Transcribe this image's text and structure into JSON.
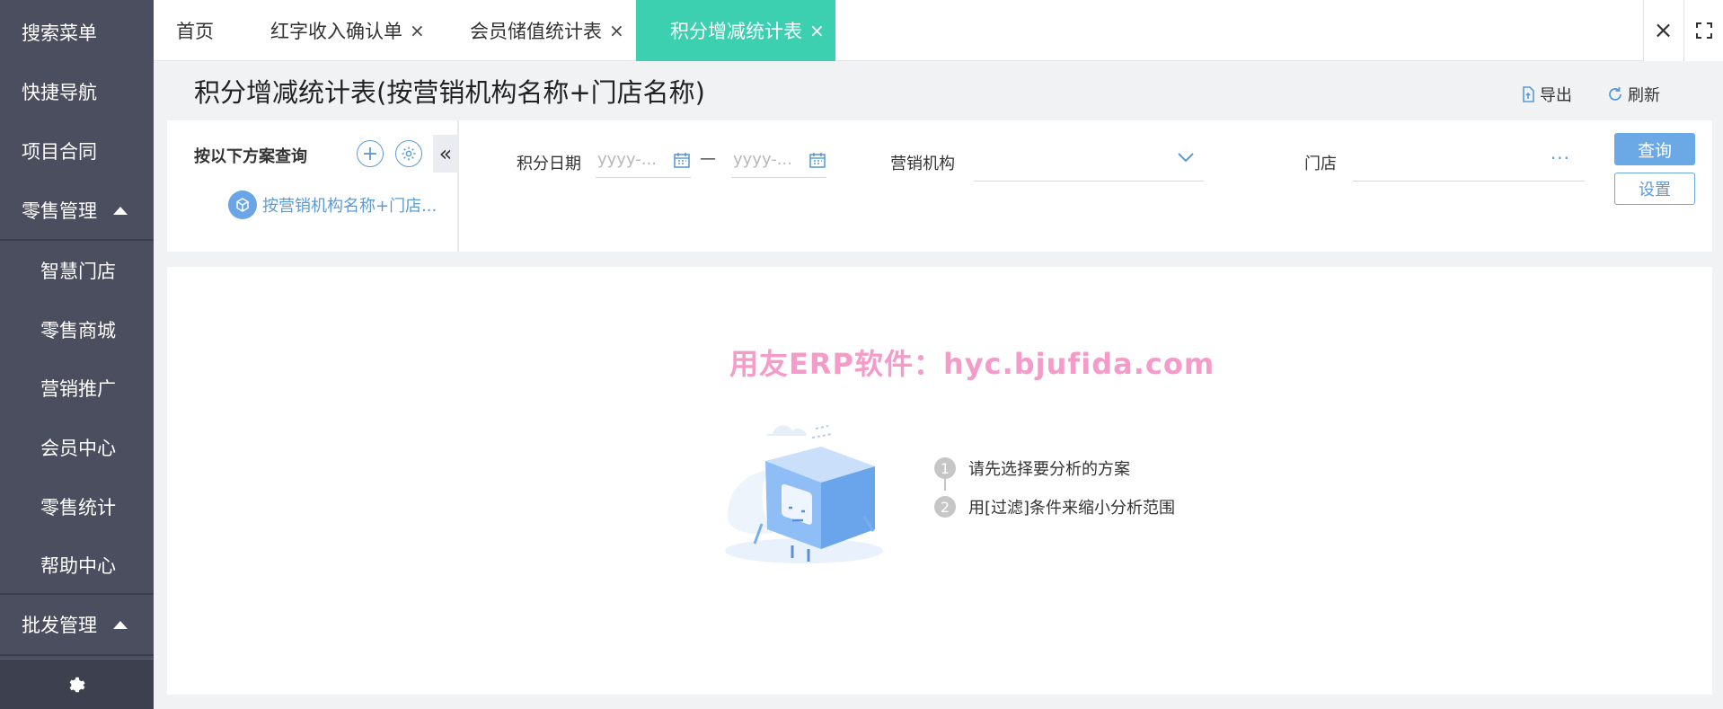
{
  "sidebar": {
    "items": [
      {
        "label": "搜索菜单",
        "type": "top"
      },
      {
        "label": "快捷导航",
        "type": "top"
      },
      {
        "label": "项目合同",
        "type": "top"
      },
      {
        "label": "零售管理",
        "type": "group",
        "expanded": true
      },
      {
        "label": "智慧门店",
        "type": "sub"
      },
      {
        "label": "零售商城",
        "type": "sub"
      },
      {
        "label": "营销推广",
        "type": "sub"
      },
      {
        "label": "会员中心",
        "type": "sub"
      },
      {
        "label": "零售统计",
        "type": "sub"
      },
      {
        "label": "帮助中心",
        "type": "sub"
      },
      {
        "label": "批发管理",
        "type": "group",
        "expanded": true
      }
    ],
    "bottom_icon": "gear-icon"
  },
  "tabs": [
    {
      "label": "首页",
      "closable": false,
      "active": false
    },
    {
      "label": "红字收入确认单",
      "closable": true,
      "active": false
    },
    {
      "label": "会员储值统计表",
      "closable": true,
      "active": false
    },
    {
      "label": "积分增减统计表",
      "closable": true,
      "active": true
    }
  ],
  "tab_close_glyph": "×",
  "page": {
    "title": "积分增减统计表(按营销机构名称+门店名称)",
    "export_label": "导出",
    "refresh_label": "刷新"
  },
  "scheme": {
    "label": "按以下方案查询",
    "add_glyph": "+",
    "collapse_glyph": "«",
    "item": "按营销机构名称+门店..."
  },
  "filters": {
    "date_label": "积分日期",
    "date_start_placeholder": "yyyy-...",
    "date_end_placeholder": "yyyy-...",
    "date_separator": "—",
    "org_label": "营销机构",
    "org_value": "",
    "store_label": "门店",
    "store_value": "",
    "store_ref_glyph": "···",
    "query_button": "查询",
    "setting_button": "设置"
  },
  "content": {
    "watermark": "用友ERP软件：hyc.bjufida.com",
    "hints": [
      {
        "num": "1",
        "text": "请先选择要分析的方案"
      },
      {
        "num": "2",
        "text": "用[过滤]条件来缩小分析范围"
      }
    ]
  },
  "colors": {
    "sidebar_bg": "#4a4e5e",
    "active_tab": "#3ccfb0",
    "primary": "#6aa8e6",
    "link": "#5b9bd5",
    "watermark": "#f59bc9"
  }
}
